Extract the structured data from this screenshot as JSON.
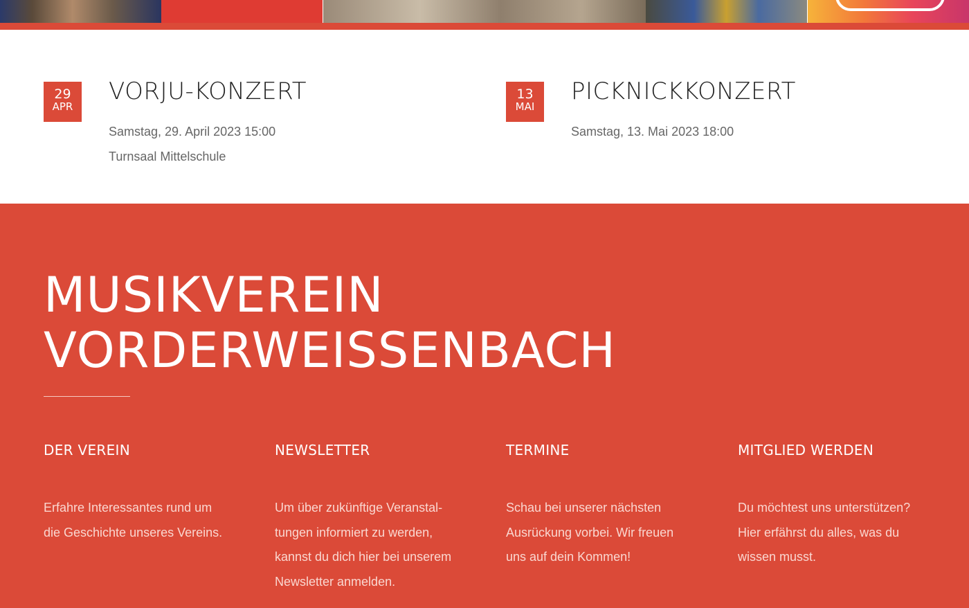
{
  "events": [
    {
      "day": "29",
      "month": "APR",
      "title": "VORJU-KONZERT",
      "datetime": "Samstag, 29. April 2023 15:00",
      "location": "Turnsaal Mittelschule"
    },
    {
      "day": "13",
      "month": "MAI",
      "title": "PICKNICKKONZERT",
      "datetime": "Samstag, 13. Mai 2023 18:00",
      "location": ""
    }
  ],
  "footer": {
    "brand_line1": "MUSIKVEREIN",
    "brand_line2": "VORDERWEISSENBACH",
    "columns": [
      {
        "heading": "DER VEREIN",
        "lines": [
          "Erfahre Interessantes rund um",
          "die Geschichte unseres Vereins."
        ]
      },
      {
        "heading": "NEWSLETTER",
        "lines": [
          "Um über zukünftige Veranstal-",
          "tungen informiert zu werden,",
          "kannst du dich hier bei unserem",
          "Newsletter anmelden."
        ]
      },
      {
        "heading": "TERMINE",
        "lines": [
          "Schau bei unserer nächsten",
          "Ausrückung vorbei. Wir freuen",
          "uns auf dein Kommen!"
        ]
      },
      {
        "heading": "MITGLIED WERDEN",
        "lines": [
          "Du möchtest uns unterstützen?",
          "Hier erfährst du alles, was du",
          "wissen musst."
        ]
      }
    ]
  },
  "colors": {
    "accent": "#db4a38",
    "white": "#ffffff"
  }
}
